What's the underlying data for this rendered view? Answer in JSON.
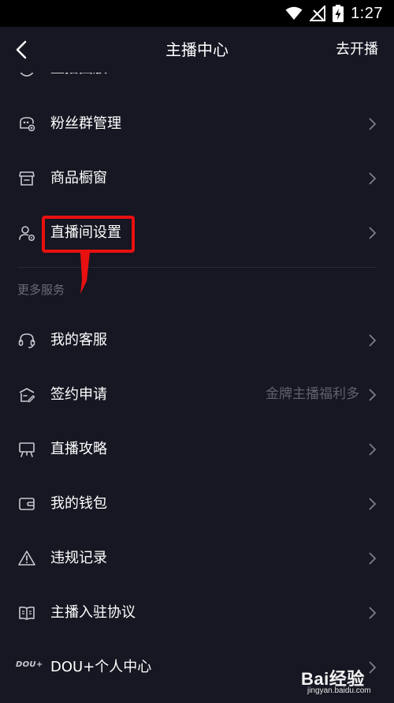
{
  "status_bar": {
    "time": "1:27"
  },
  "header": {
    "title": "主播中心",
    "action": "去开播"
  },
  "partial_item": {
    "label": "直播回放"
  },
  "items": [
    {
      "label": "粉丝群管理",
      "icon": "fan-group-icon"
    },
    {
      "label": "商品橱窗",
      "icon": "shop-window-icon"
    },
    {
      "label": "直播间设置",
      "icon": "live-room-settings-icon"
    }
  ],
  "more_services": {
    "title": "更多服务",
    "items": [
      {
        "label": "我的客服",
        "icon": "headset-icon"
      },
      {
        "label": "签约申请",
        "icon": "contract-icon",
        "hint": "金牌主播福利多"
      },
      {
        "label": "直播攻略",
        "icon": "easel-icon"
      },
      {
        "label": "我的钱包",
        "icon": "wallet-icon"
      },
      {
        "label": "违规记录",
        "icon": "warning-icon"
      },
      {
        "label": "主播入驻协议",
        "icon": "book-icon"
      },
      {
        "label": "DOU+个人中心",
        "icon": "dou-plus-icon",
        "icon_text": "DOU+"
      }
    ]
  },
  "watermark": {
    "text": "Bai经验",
    "url": "jingyan.baidu.com"
  },
  "colors": {
    "background": "#161722",
    "highlight": "#e81010",
    "secondary_text": "#5f6070"
  }
}
